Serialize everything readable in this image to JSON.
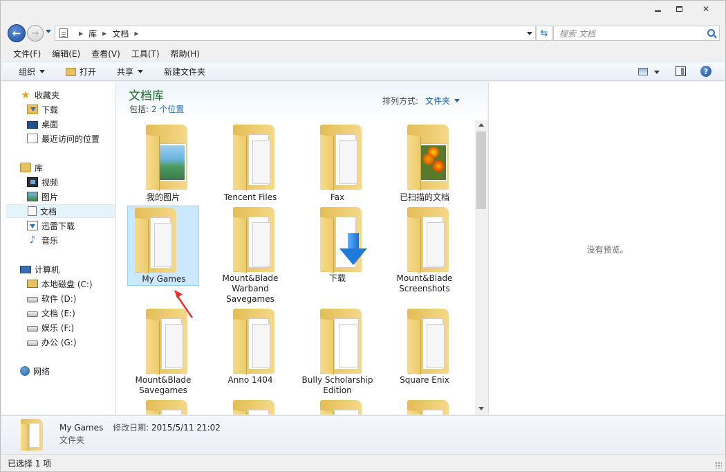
{
  "window": {
    "min_label": "",
    "max_label": "",
    "close_label": "✕"
  },
  "address": {
    "crumbs": [
      "库",
      "文档"
    ],
    "search_placeholder": "搜索 文档"
  },
  "menu": [
    "文件(F)",
    "编辑(E)",
    "查看(V)",
    "工具(T)",
    "帮助(H)"
  ],
  "commands": {
    "organize": "组织",
    "open": "打开",
    "share": "共享",
    "new_folder": "新建文件夹"
  },
  "nav": {
    "favorites": "收藏夹",
    "downloads": "下载",
    "desktop": "桌面",
    "recent": "最近访问的位置",
    "libraries": "库",
    "videos": "视频",
    "pictures": "图片",
    "documents": "文档",
    "xunlei": "迅雷下载",
    "music": "音乐",
    "computer": "计算机",
    "drive_c": "本地磁盘 (C:)",
    "drive_d": "软件 (D:)",
    "drive_e": "文档 (E:)",
    "drive_f": "娱乐 (F:)",
    "drive_g": "办公 (G:)",
    "network": "网络"
  },
  "library": {
    "title": "文档库",
    "include_label": "包括:",
    "include_link": "2 个位置",
    "arrange_label": "排列方式:",
    "arrange_value": "文件夹"
  },
  "items": [
    {
      "label": "我的图片",
      "kind": "pictures"
    },
    {
      "label": "Tencent Files",
      "kind": "folder"
    },
    {
      "label": "Fax",
      "kind": "folder"
    },
    {
      "label": "已扫描的文档",
      "kind": "photo"
    },
    {
      "label": "My Games",
      "kind": "folder",
      "selected": true
    },
    {
      "label": "Mount&Blade Warband Savegames",
      "kind": "folder"
    },
    {
      "label": "下载",
      "kind": "download"
    },
    {
      "label": "Mount&Blade Screenshots",
      "kind": "folder"
    },
    {
      "label": "Mount&Blade Savegames",
      "kind": "folder"
    },
    {
      "label": "Anno 1404",
      "kind": "folder"
    },
    {
      "label": "Bully Scholarship Edition",
      "kind": "folder"
    },
    {
      "label": "Square Enix",
      "kind": "folder"
    }
  ],
  "preview": {
    "text": "没有预览。"
  },
  "details": {
    "name": "My Games",
    "date_label": "修改日期:",
    "date_value": "2015/5/11 21:02",
    "type": "文件夹"
  },
  "status": {
    "text": "已选择 1 项"
  }
}
